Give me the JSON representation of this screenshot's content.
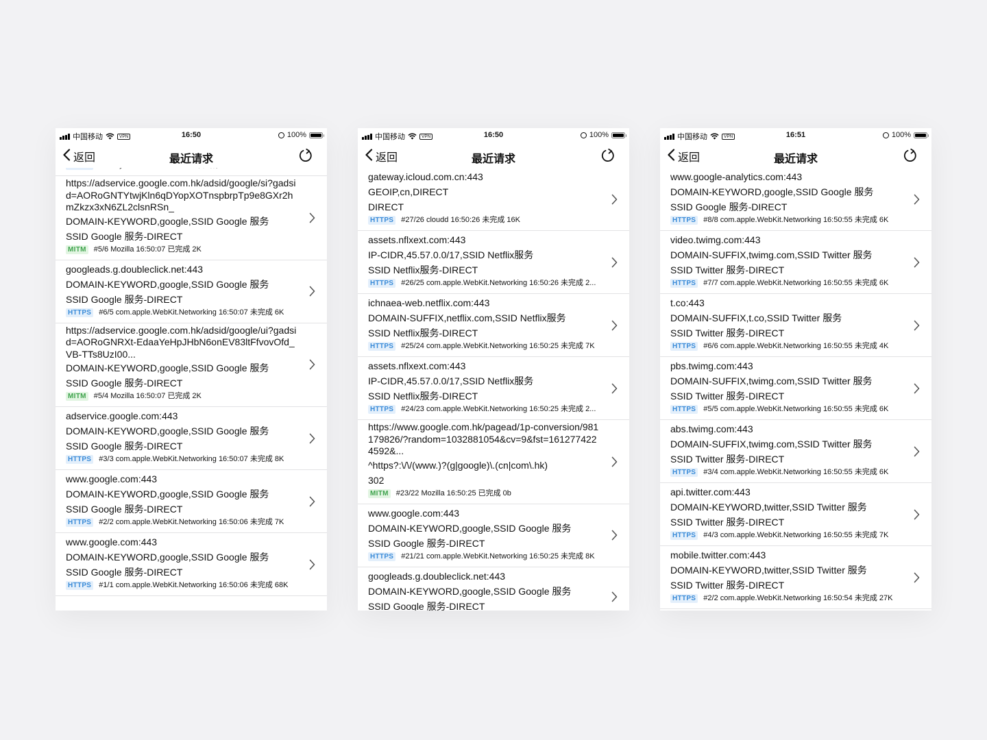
{
  "screens": [
    {
      "status": {
        "carrier": "中国移动",
        "vpn": "VPN",
        "time": "16:50",
        "battery": "100%"
      },
      "nav": {
        "back": "返回",
        "title": "最近请求"
      },
      "partial_top": "#7/7 syncdefaultsd 16:50:08 未完成 0b",
      "items": [
        {
          "lines": [
            "https://adservice.google.com.hk/adsid/google/si?gadsid=AORoGNTYtwjKln6qDYopXOTnspbrpTp9e8GXr2hmZkzx3xN6ZL2clsnRSn_",
            "DOMAIN-KEYWORD,google,SSID Google 服务",
            "SSID Google 服务-DIRECT"
          ],
          "url": true,
          "badge": "MITM",
          "meta": "#5/6 Mozilla 16:50:07 已完成 2K"
        },
        {
          "lines": [
            "googleads.g.doubleclick.net:443",
            "DOMAIN-KEYWORD,google,SSID Google 服务",
            "SSID Google 服务-DIRECT"
          ],
          "badge": "HTTPS",
          "meta": "#6/5 com.apple.WebKit.Networking 16:50:07 未完成 6K"
        },
        {
          "lines": [
            "https://adservice.google.com.hk/adsid/google/ui?gadsid=AORoGNRXt-EdaaYeHpJHbN6onEV83ltFfvovOfd_VB-TTs8UzI00...",
            "DOMAIN-KEYWORD,google,SSID Google 服务",
            "SSID Google 服务-DIRECT"
          ],
          "url": true,
          "badge": "MITM",
          "meta": "#5/4 Mozilla 16:50:07 已完成 2K"
        },
        {
          "lines": [
            "adservice.google.com:443",
            "DOMAIN-KEYWORD,google,SSID Google 服务",
            "SSID Google 服务-DIRECT"
          ],
          "badge": "HTTPS",
          "meta": "#3/3 com.apple.WebKit.Networking 16:50:07 未完成 8K"
        },
        {
          "lines": [
            "www.google.com:443",
            "DOMAIN-KEYWORD,google,SSID Google 服务",
            "SSID Google 服务-DIRECT"
          ],
          "badge": "HTTPS",
          "meta": "#2/2 com.apple.WebKit.Networking 16:50:06 未完成 7K"
        },
        {
          "lines": [
            "www.google.com:443",
            "DOMAIN-KEYWORD,google,SSID Google 服务",
            "SSID Google 服务-DIRECT"
          ],
          "badge": "HTTPS",
          "meta": "#1/1 com.apple.WebKit.Networking 16:50:06 未完成 68K"
        }
      ]
    },
    {
      "status": {
        "carrier": "中国移动",
        "vpn": "VPN",
        "time": "16:50",
        "battery": "100%"
      },
      "nav": {
        "back": "返回",
        "title": "最近请求"
      },
      "items": [
        {
          "lines": [
            "gateway.icloud.com.cn:443",
            "GEOIP,cn,DIRECT",
            "DIRECT"
          ],
          "badge": "HTTPS",
          "meta": "#27/26 cloudd 16:50:26 未完成 16K"
        },
        {
          "lines": [
            "assets.nflxext.com:443",
            "IP-CIDR,45.57.0.0/17,SSID Netflix服务",
            "SSID Netflix服务-DIRECT"
          ],
          "badge": "HTTPS",
          "meta": "#26/25 com.apple.WebKit.Networking 16:50:26 未完成 2..."
        },
        {
          "lines": [
            "ichnaea-web.netflix.com:443",
            "DOMAIN-SUFFIX,netflix.com,SSID Netflix服务",
            "SSID Netflix服务-DIRECT"
          ],
          "badge": "HTTPS",
          "meta": "#25/24 com.apple.WebKit.Networking 16:50:25 未完成 7K"
        },
        {
          "lines": [
            "assets.nflxext.com:443",
            "IP-CIDR,45.57.0.0/17,SSID Netflix服务",
            "SSID Netflix服务-DIRECT"
          ],
          "badge": "HTTPS",
          "meta": "#24/23 com.apple.WebKit.Networking 16:50:25 未完成 2..."
        },
        {
          "lines": [
            "https://www.google.com.hk/pagead/1p-conversion/981179826/?random=1032881054&cv=9&fst=1612774224592&...",
            "^https?:\\/\\/(www.)?(g|google)\\.(cn|com\\.hk)",
            "302"
          ],
          "url": true,
          "badge": "MITM",
          "meta": "#23/22 Mozilla 16:50:25 已完成 0b"
        },
        {
          "lines": [
            "www.google.com:443",
            "DOMAIN-KEYWORD,google,SSID Google 服务",
            "SSID Google 服务-DIRECT"
          ],
          "badge": "HTTPS",
          "meta": "#21/21 com.apple.WebKit.Networking 16:50:25 未完成 8K"
        },
        {
          "lines": [
            "googleads.g.doubleclick.net:443",
            "DOMAIN-KEYWORD,google,SSID Google 服务",
            "SSID Google 服务-DIRECT"
          ],
          "badge": "HTTPS",
          "meta": ""
        }
      ]
    },
    {
      "status": {
        "carrier": "中国移动",
        "vpn": "VPN",
        "time": "16:51",
        "battery": "100%"
      },
      "nav": {
        "back": "返回",
        "title": "最近请求"
      },
      "items": [
        {
          "lines": [
            "www.google-analytics.com:443",
            "DOMAIN-KEYWORD,google,SSID Google 服务",
            "SSID Google 服务-DIRECT"
          ],
          "badge": "HTTPS",
          "meta": "#8/8 com.apple.WebKit.Networking 16:50:55 未完成 6K"
        },
        {
          "lines": [
            "video.twimg.com:443",
            "DOMAIN-SUFFIX,twimg.com,SSID Twitter 服务",
            "SSID Twitter 服务-DIRECT"
          ],
          "badge": "HTTPS",
          "meta": "#7/7 com.apple.WebKit.Networking 16:50:55 未完成 6K"
        },
        {
          "lines": [
            "t.co:443",
            "DOMAIN-SUFFIX,t.co,SSID Twitter 服务",
            "SSID Twitter 服务-DIRECT"
          ],
          "badge": "HTTPS",
          "meta": "#6/6 com.apple.WebKit.Networking 16:50:55 未完成 4K"
        },
        {
          "lines": [
            "pbs.twimg.com:443",
            "DOMAIN-SUFFIX,twimg.com,SSID Twitter 服务",
            "SSID Twitter 服务-DIRECT"
          ],
          "badge": "HTTPS",
          "meta": "#5/5 com.apple.WebKit.Networking 16:50:55 未完成 6K"
        },
        {
          "lines": [
            "abs.twimg.com:443",
            "DOMAIN-SUFFIX,twimg.com,SSID Twitter 服务",
            "SSID Twitter 服务-DIRECT"
          ],
          "badge": "HTTPS",
          "meta": "#3/4 com.apple.WebKit.Networking 16:50:55 未完成 6K"
        },
        {
          "lines": [
            "api.twitter.com:443",
            "DOMAIN-KEYWORD,twitter,SSID Twitter 服务",
            "SSID Twitter 服务-DIRECT"
          ],
          "badge": "HTTPS",
          "meta": "#4/3 com.apple.WebKit.Networking 16:50:55 未完成 7K"
        },
        {
          "lines": [
            "mobile.twitter.com:443",
            "DOMAIN-KEYWORD,twitter,SSID Twitter 服务",
            "SSID Twitter 服务-DIRECT"
          ],
          "badge": "HTTPS",
          "meta": "#2/2 com.apple.WebKit.Networking 16:50:54 未完成 27K"
        }
      ]
    }
  ],
  "colors": {
    "https_badge": "#3a8bd8",
    "mitm_badge": "#3fa34d",
    "background": "#f2f2f4"
  }
}
